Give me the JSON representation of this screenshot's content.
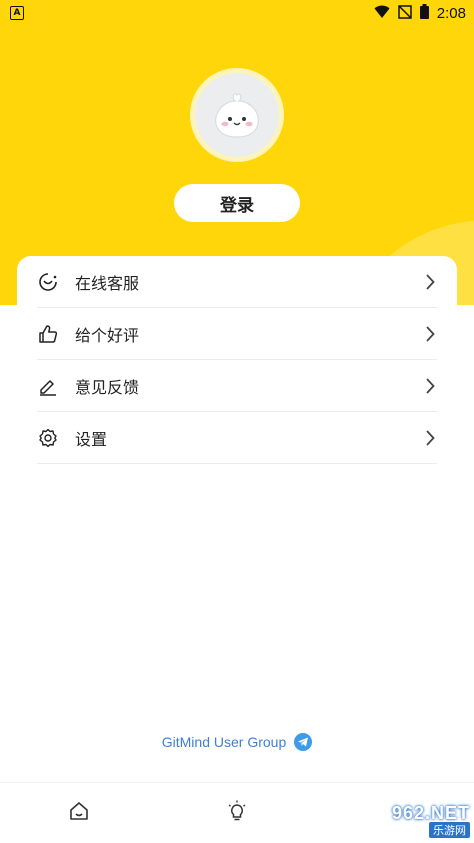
{
  "status_bar": {
    "time": "2:08",
    "app_indicator": "A"
  },
  "profile": {
    "login_label": "登录"
  },
  "menu": {
    "items": [
      {
        "label": "在线客服",
        "icon": "support-chat-icon"
      },
      {
        "label": "给个好评",
        "icon": "thumbs-up-icon"
      },
      {
        "label": "意见反馈",
        "icon": "edit-feedback-icon"
      },
      {
        "label": "设置",
        "icon": "gear-icon"
      }
    ]
  },
  "group_link": {
    "label": "GitMind User Group",
    "icon": "telegram-icon"
  },
  "bottom_nav": {
    "tabs": [
      {
        "icon": "home-icon"
      },
      {
        "icon": "lightbulb-icon"
      },
      {
        "icon": "profile-icon"
      }
    ]
  },
  "watermark": {
    "top": "962.NET",
    "bottom": "乐游网"
  },
  "colors": {
    "hero": "#FFD60A",
    "accent_link": "#3D7FD6"
  }
}
